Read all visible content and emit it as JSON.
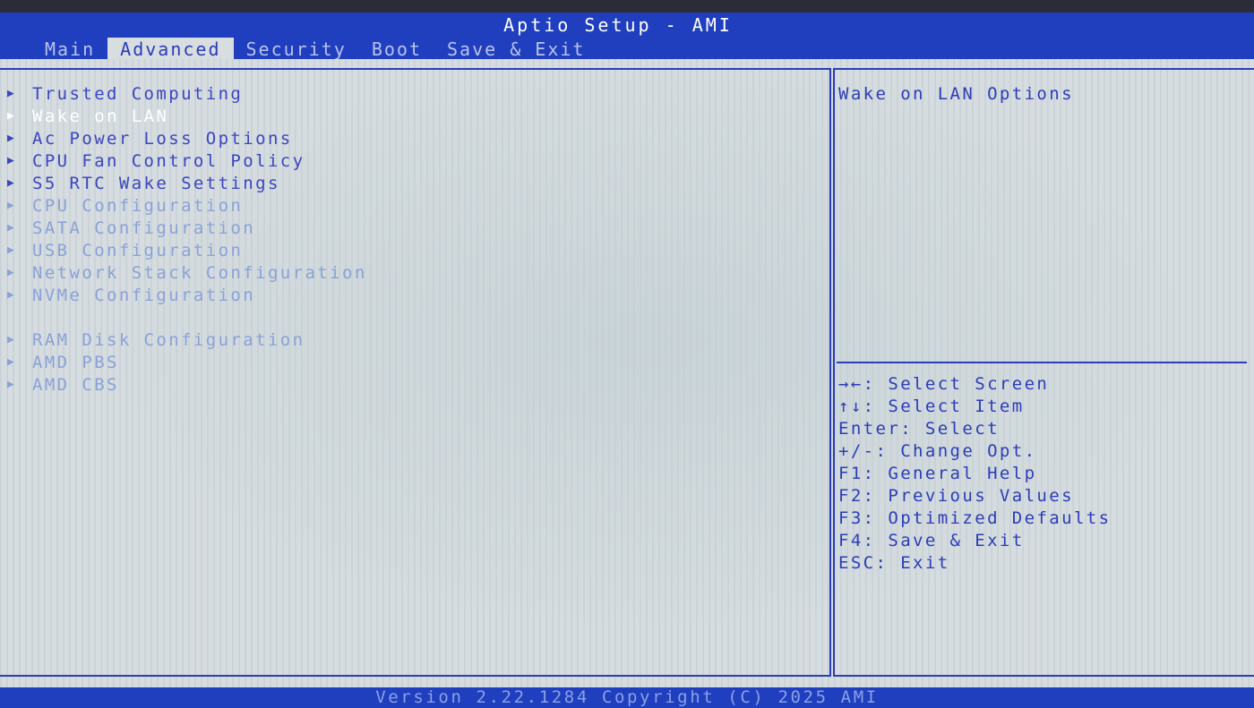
{
  "header": {
    "title": "Aptio Setup - AMI",
    "tabs": [
      {
        "label": "Main"
      },
      {
        "label": "Advanced"
      },
      {
        "label": "Security"
      },
      {
        "label": "Boot"
      },
      {
        "label": "Save & Exit"
      }
    ],
    "active_tab": "Advanced"
  },
  "menu": {
    "items": [
      {
        "label": "Trusted Computing"
      },
      {
        "label": "Wake on LAN"
      },
      {
        "label": "Ac Power Loss Options"
      },
      {
        "label": "CPU Fan Control Policy"
      },
      {
        "label": "S5 RTC Wake Settings"
      },
      {
        "label": "CPU Configuration"
      },
      {
        "label": "SATA Configuration"
      },
      {
        "label": "USB Configuration"
      },
      {
        "label": "Network Stack Configuration"
      },
      {
        "label": "NVMe Configuration"
      },
      {
        "label": "RAM Disk Configuration"
      },
      {
        "label": "AMD PBS"
      },
      {
        "label": "AMD CBS"
      }
    ],
    "selected": "Wake on LAN",
    "arrow_glyph": "▶"
  },
  "help": {
    "title": "Wake on LAN Options"
  },
  "keys": [
    {
      "text": "→←: Select Screen"
    },
    {
      "text": "↑↓: Select Item"
    },
    {
      "text": "Enter: Select"
    },
    {
      "text": "+/-: Change Opt."
    },
    {
      "text": "F1: General Help"
    },
    {
      "text": "F2: Previous Values"
    },
    {
      "text": "F3: Optimized Defaults"
    },
    {
      "text": "F4: Save & Exit"
    },
    {
      "text": "ESC: Exit"
    }
  ],
  "footer": {
    "version": "Version 2.22.1284 Copyright (C) 2025 AMI"
  },
  "colors": {
    "header_bg": "#1f3fbf",
    "body_bg": "#d6dcdf",
    "menu_text": "#3b46c0",
    "menu_dim_text": "#8aa2d8",
    "selected_text": "#ffffff",
    "border": "#2b3db7"
  }
}
